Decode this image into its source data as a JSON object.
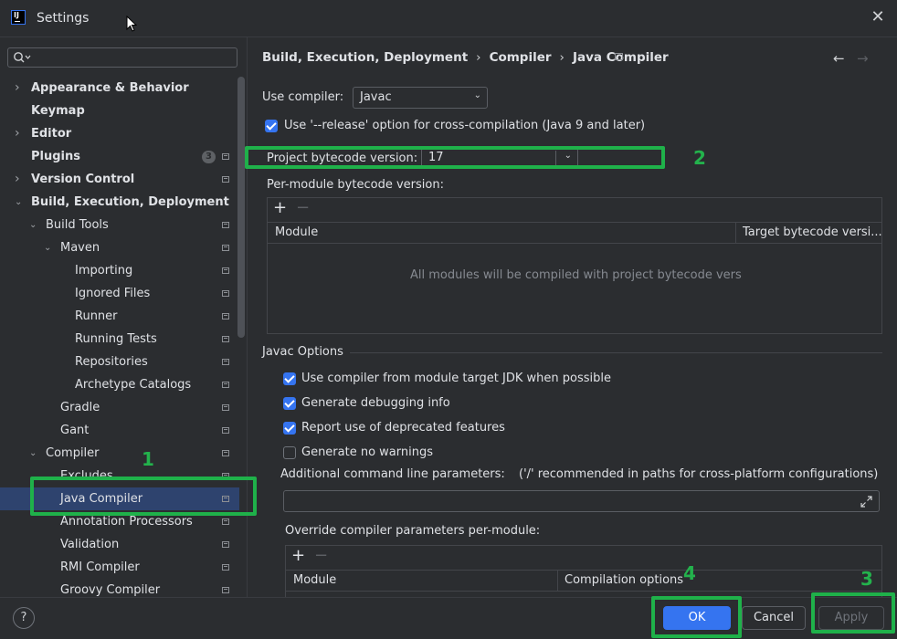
{
  "window": {
    "title": "Settings",
    "logo_text": "IJ",
    "close_glyph": "✕"
  },
  "search": {
    "placeholder": ""
  },
  "tree": [
    {
      "label": "Appearance & Behavior",
      "bold": true,
      "level": 0,
      "arrow": "right"
    },
    {
      "label": "Keymap",
      "bold": true,
      "level": 0,
      "arrow": ""
    },
    {
      "label": "Editor",
      "bold": true,
      "level": 0,
      "arrow": "right"
    },
    {
      "label": "Plugins",
      "bold": true,
      "level": 0,
      "arrow": "",
      "badge": "3",
      "pin": true
    },
    {
      "label": "Version Control",
      "bold": true,
      "level": 0,
      "arrow": "right",
      "pin": true
    },
    {
      "label": "Build, Execution, Deployment",
      "bold": true,
      "level": 0,
      "arrow": "down"
    },
    {
      "label": "Build Tools",
      "level": 1,
      "arrow": "down",
      "pin": true
    },
    {
      "label": "Maven",
      "level": 2,
      "arrow": "down",
      "pin": true
    },
    {
      "label": "Importing",
      "level": 3,
      "arrow": "",
      "pin": true
    },
    {
      "label": "Ignored Files",
      "level": 3,
      "arrow": "",
      "pin": true
    },
    {
      "label": "Runner",
      "level": 3,
      "arrow": "",
      "pin": true
    },
    {
      "label": "Running Tests",
      "level": 3,
      "arrow": "",
      "pin": true
    },
    {
      "label": "Repositories",
      "level": 3,
      "arrow": "",
      "pin": true
    },
    {
      "label": "Archetype Catalogs",
      "level": 3,
      "arrow": "",
      "pin": true
    },
    {
      "label": "Gradle",
      "level": 2,
      "arrow": "",
      "pin": true
    },
    {
      "label": "Gant",
      "level": 2,
      "arrow": "",
      "pin": true
    },
    {
      "label": "Compiler",
      "level": 1,
      "arrow": "down",
      "pin": true
    },
    {
      "label": "Excludes",
      "level": 2,
      "arrow": "",
      "pin": true
    },
    {
      "label": "Java Compiler",
      "level": 2,
      "arrow": "",
      "pin": true,
      "selected": true
    },
    {
      "label": "Annotation Processors",
      "level": 2,
      "arrow": "",
      "pin": true
    },
    {
      "label": "Validation",
      "level": 2,
      "arrow": "",
      "pin": true
    },
    {
      "label": "RMI Compiler",
      "level": 2,
      "arrow": "",
      "pin": true
    },
    {
      "label": "Groovy Compiler",
      "level": 2,
      "arrow": "",
      "pin": true
    }
  ],
  "breadcrumb": {
    "items": [
      "Build, Execution, Deployment",
      "Compiler",
      "Java Compiler"
    ],
    "separator": "›"
  },
  "nav": {
    "back": "←",
    "forward": "→"
  },
  "use_compiler": {
    "label": "Use compiler:",
    "value": "Javac"
  },
  "release_option": {
    "label": "Use '--release' option for cross-compilation (Java 9 and later)",
    "checked": true
  },
  "project_bytecode": {
    "label": "Project bytecode version:",
    "value": "17"
  },
  "per_module": {
    "label": "Per-module bytecode version:",
    "columns": [
      "Module",
      "Target bytecode versi..."
    ],
    "empty_text": "All modules will be compiled with project bytecode version"
  },
  "javac_options": {
    "title": "Javac Options",
    "checkboxes": [
      {
        "label": "Use compiler from module target JDK when possible",
        "checked": true
      },
      {
        "label": "Generate debugging info",
        "checked": true
      },
      {
        "label": "Report use of deprecated features",
        "checked": true
      },
      {
        "label": "Generate no warnings",
        "checked": false
      }
    ],
    "additional_label": "Additional command line parameters:",
    "additional_hint": "('/' recommended in paths for cross-platform configurations)",
    "additional_value": "",
    "override_label": "Override compiler parameters per-module:",
    "override_columns": [
      "Module",
      "Compilation options"
    ]
  },
  "buttons": {
    "help": "?",
    "ok": "OK",
    "cancel": "Cancel",
    "apply": "Apply"
  },
  "annotations": [
    "1",
    "2",
    "3",
    "4"
  ],
  "colors": {
    "accent": "#3574f0",
    "highlight": "#1fb14a",
    "selection": "#2e436e",
    "background": "#2b2d30"
  }
}
